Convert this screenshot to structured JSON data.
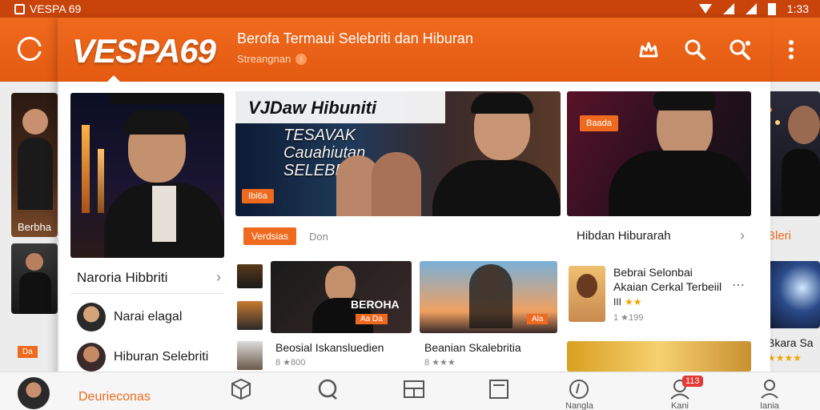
{
  "status_bar": {
    "app_name": "VESPA 69",
    "time": "1:33"
  },
  "header": {
    "logo": "VESPA69",
    "title": "Berofa Termaui Selebriti dan Hiburan",
    "subtitle": "Streangnan",
    "subtitle_badge": "i"
  },
  "cards": {
    "left_edge_label": "Berbha",
    "left_edge_small_tag": "Da",
    "featured_title": "Naroria Hibbriti",
    "banner_title": "VJDaw Hibuniti",
    "banner_overlay": "TESAVAK Cauahiutan SELEBRITIS",
    "banner_tag": "Ibi6a",
    "right_banner_tag": "Baada",
    "right_edge_label": "Bleri",
    "right_edge_bottom": "Bkara Sa"
  },
  "section": {
    "tag_label": "Verdsias",
    "tag_muted": "Don",
    "right_header": "Hibdan Hiburarah"
  },
  "left_list": [
    {
      "label": "Narai elagal",
      "meta": ""
    },
    {
      "label": "Hiburan Selebriti",
      "meta": ""
    }
  ],
  "grid": [
    {
      "title": "Beosial Iskansluedien",
      "meta": "8 ★800",
      "overlay": "BEROHA",
      "tag": "Aa Da"
    },
    {
      "title": "Beanian Skalebritia",
      "meta": "8 ★★★",
      "tag": "Ala"
    }
  ],
  "right_list": {
    "title": "Bebrai Selonbai",
    "subtitle": "Akaian Cerkal Terbeiil",
    "rating_prefix": "III",
    "meta": "1 ★199"
  },
  "bottom_nav": {
    "first_label": "Deurieconas",
    "items": [
      {
        "label": ""
      },
      {
        "label": ""
      },
      {
        "label": ""
      },
      {
        "label": ""
      },
      {
        "label": "Nangla"
      },
      {
        "label": "Kani",
        "badge": "113"
      },
      {
        "label": "Iania"
      }
    ]
  },
  "colors": {
    "accent": "#ef6a1f",
    "appbar": "#e8600f",
    "statusbar": "#c9440b"
  }
}
